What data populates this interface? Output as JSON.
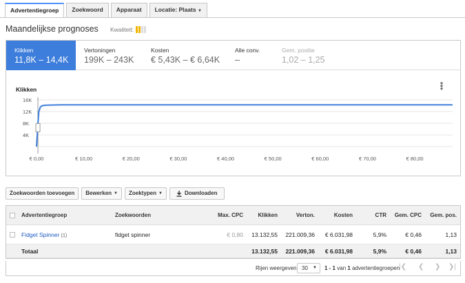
{
  "tabs": [
    {
      "label": "Advertentiegroep",
      "active": true
    },
    {
      "label": "Zoekwoord",
      "active": false
    },
    {
      "label": "Apparaat",
      "active": false
    },
    {
      "label": "Locatie: Plaats",
      "active": false,
      "dropdown": true
    }
  ],
  "heading": "Maandelijkse prognoses",
  "quality": {
    "label": "Kwaliteit:",
    "level": 2,
    "max": 4,
    "color_on": "#f2b400",
    "color_off": "#ddd"
  },
  "metrics": [
    {
      "label": "Klikken",
      "value": "11,8K – 14,4K",
      "active": true
    },
    {
      "label": "Vertoningen",
      "value": "199K – 243K"
    },
    {
      "label": "Kosten",
      "value": "€ 5,43K – € 6,64K"
    },
    {
      "label": "Alle conv.",
      "value": "–"
    },
    {
      "label": "Gem. positie",
      "value": "1,02 – 1,25",
      "disabled": true
    }
  ],
  "chart_data": {
    "type": "line",
    "title": "Klikken",
    "xlabel": "",
    "ylabel": "",
    "x_ticks": [
      "€ 0,00",
      "€ 10,00",
      "€ 20,00",
      "€ 30,00",
      "€ 40,00",
      "€ 50,00",
      "€ 60,00",
      "€ 70,00",
      "€ 80,00"
    ],
    "y_ticks": [
      "4K",
      "8K",
      "12K",
      "16K"
    ],
    "xlim": [
      0,
      88
    ],
    "ylim": [
      0,
      16000
    ],
    "grid": true,
    "line_color": "#3d7ddb",
    "series": [
      {
        "x": [
          0,
          0.3,
          0.5,
          0.8,
          1.2,
          2,
          5,
          20,
          40,
          60,
          88
        ],
        "y": [
          0,
          8000,
          12000,
          13500,
          14000,
          14200,
          14300,
          14300,
          14300,
          14300,
          14300
        ]
      }
    ],
    "marker_x": 0.3,
    "marker_y": 6500
  },
  "toolbar": {
    "add_keywords": "Zoekwoorden toevoegen",
    "edit": "Bewerken",
    "match_types": "Zoektypen",
    "download": "Downloaden"
  },
  "table": {
    "headers": [
      "Advertentiegroep",
      "Zoekwoorden",
      "Max. CPC",
      "Klikken",
      "Verton.",
      "Kosten",
      "CTR",
      "Gem. CPC",
      "Gem. pos."
    ],
    "row": {
      "ad_group": "Fidget Spinner",
      "count": "(1)",
      "keyword": "fidget spinner",
      "max_cpc": "€ 0,80",
      "clicks": "13.132,55",
      "impr": "221.009,36",
      "cost": "€ 6.031,98",
      "ctr": "5,9%",
      "avg_cpc": "€ 0,46",
      "avg_pos": "1,13"
    },
    "total": {
      "label": "Totaal",
      "clicks": "13.132,55",
      "impr": "221.009,36",
      "cost": "€ 6.031,98",
      "ctr": "5,9%",
      "avg_cpc": "€ 0,46",
      "avg_pos": "1,13"
    }
  },
  "footer": {
    "rows_label": "Rijen weergeven:",
    "rows_value": "30",
    "range_prefix": "1 - 1",
    "range_of": "van",
    "range_total": "1",
    "range_suffix": "advertentiegroepen"
  }
}
